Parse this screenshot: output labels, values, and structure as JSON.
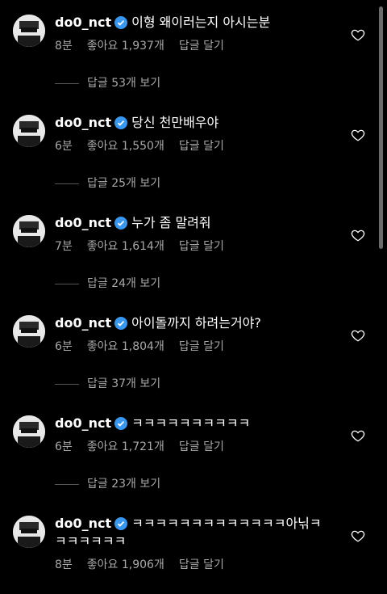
{
  "comments": [
    {
      "username": "do0_nct",
      "text": "이형 왜이러는지 아시는분",
      "time": "8분",
      "likes": "좋아요 1,937개",
      "reply": "답글 달기",
      "view_replies": "답글 53개 보기"
    },
    {
      "username": "do0_nct",
      "text": "당신 천만배우야",
      "time": "6분",
      "likes": "좋아요 1,550개",
      "reply": "답글 달기",
      "view_replies": "답글 25개 보기"
    },
    {
      "username": "do0_nct",
      "text": "누가 좀 말려줘",
      "time": "7분",
      "likes": "좋아요 1,614개",
      "reply": "답글 달기",
      "view_replies": "답글 24개 보기"
    },
    {
      "username": "do0_nct",
      "text": "아이돌까지 하려는거야?",
      "time": "6분",
      "likes": "좋아요 1,804개",
      "reply": "답글 달기",
      "view_replies": "답글 37개 보기"
    },
    {
      "username": "do0_nct",
      "text": "ㅋㅋㅋㅋㅋㅋㅋㅋㅋㅋ",
      "time": "6분",
      "likes": "좋아요 1,721개",
      "reply": "답글 달기",
      "view_replies": "답글 23개 보기"
    },
    {
      "username": "do0_nct",
      "text": "ㅋㅋㅋㅋㅋㅋㅋㅋㅋㅋㅋㅋㅋ아닊ㅋ",
      "text_line2": "ㅋㅋㅋㅋㅋㅋ",
      "time": "8분",
      "likes": "좋아요 1,906개",
      "reply": "답글 달기"
    }
  ],
  "icons": {
    "verified": "verified-badge-icon",
    "like": "heart-outline-icon"
  },
  "colors": {
    "verified": "#3897f0",
    "meta": "#a8a8a8",
    "background": "#000000"
  }
}
